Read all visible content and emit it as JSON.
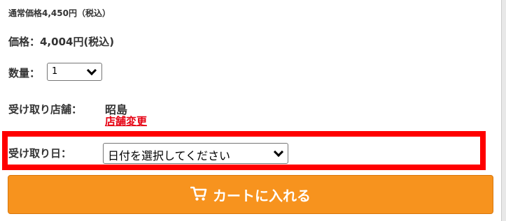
{
  "product": {
    "regular_price": "通常価格4,450円（税込）",
    "price": "価格：4,004円(税込)"
  },
  "quantity": {
    "label": "数量：",
    "selected": "1"
  },
  "store": {
    "label": "受け取り店舗：",
    "name": "昭島",
    "change_link": "店舗変更"
  },
  "pickup_date": {
    "label": "受け取り日：",
    "selected": "日付を選択してください"
  },
  "cart_button": {
    "label": "カートに入れる",
    "icon": "cart-icon"
  },
  "colors": {
    "button": "#f7931e",
    "link": "#e60012",
    "highlight": "#ff0000"
  }
}
